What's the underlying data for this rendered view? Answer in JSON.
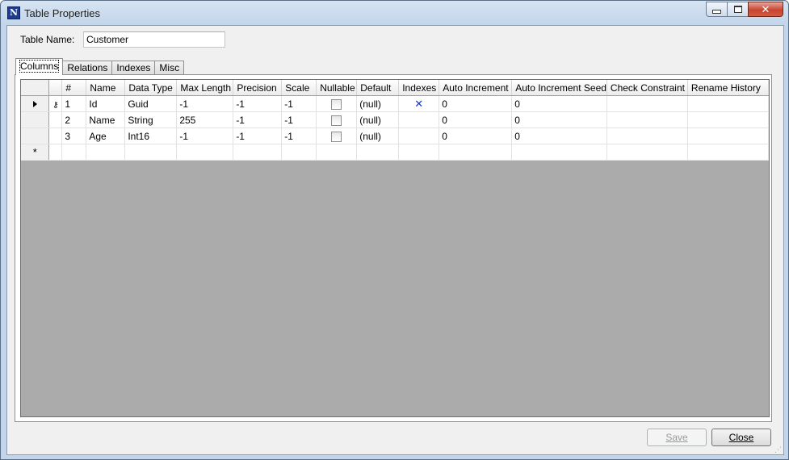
{
  "window": {
    "title": "Table Properties",
    "icon_letter": "N"
  },
  "form": {
    "table_name_label": "Table Name:",
    "table_name_value": "Customer"
  },
  "tabs": [
    {
      "label": "Columns",
      "active": true
    },
    {
      "label": "Relations",
      "active": false
    },
    {
      "label": "Indexes",
      "active": false
    },
    {
      "label": "Misc",
      "active": false
    }
  ],
  "grid": {
    "columns": [
      "#",
      "Name",
      "Data Type",
      "Max Length",
      "Precision",
      "Scale",
      "Nullable",
      "Default",
      "Indexes",
      "Auto Increment",
      "Auto Increment Seed",
      "Check Constraint",
      "Rename History"
    ],
    "rows": [
      {
        "num": "1",
        "name": "Id",
        "data_type": "Guid",
        "max_length": "-1",
        "precision": "-1",
        "scale": "-1",
        "nullable": false,
        "default": "(null)",
        "indexed": true,
        "auto_increment": "0",
        "auto_increment_seed": "0",
        "check_constraint": "",
        "rename_history": "",
        "primary_key": true,
        "current": true
      },
      {
        "num": "2",
        "name": "Name",
        "data_type": "String",
        "max_length": "255",
        "precision": "-1",
        "scale": "-1",
        "nullable": false,
        "default": "(null)",
        "indexed": false,
        "auto_increment": "0",
        "auto_increment_seed": "0",
        "check_constraint": "",
        "rename_history": "",
        "primary_key": false,
        "current": false
      },
      {
        "num": "3",
        "name": "Age",
        "data_type": "Int16",
        "max_length": "-1",
        "precision": "-1",
        "scale": "-1",
        "nullable": false,
        "default": "(null)",
        "indexed": false,
        "auto_increment": "0",
        "auto_increment_seed": "0",
        "check_constraint": "",
        "rename_history": "",
        "primary_key": false,
        "current": false
      }
    ],
    "new_row_marker": "*",
    "index_mark": "✕",
    "key_icon": "key-icon"
  },
  "buttons": {
    "save_label": "Save",
    "close_label": "Close"
  },
  "colors": {
    "index_mark": "#1133dd"
  }
}
